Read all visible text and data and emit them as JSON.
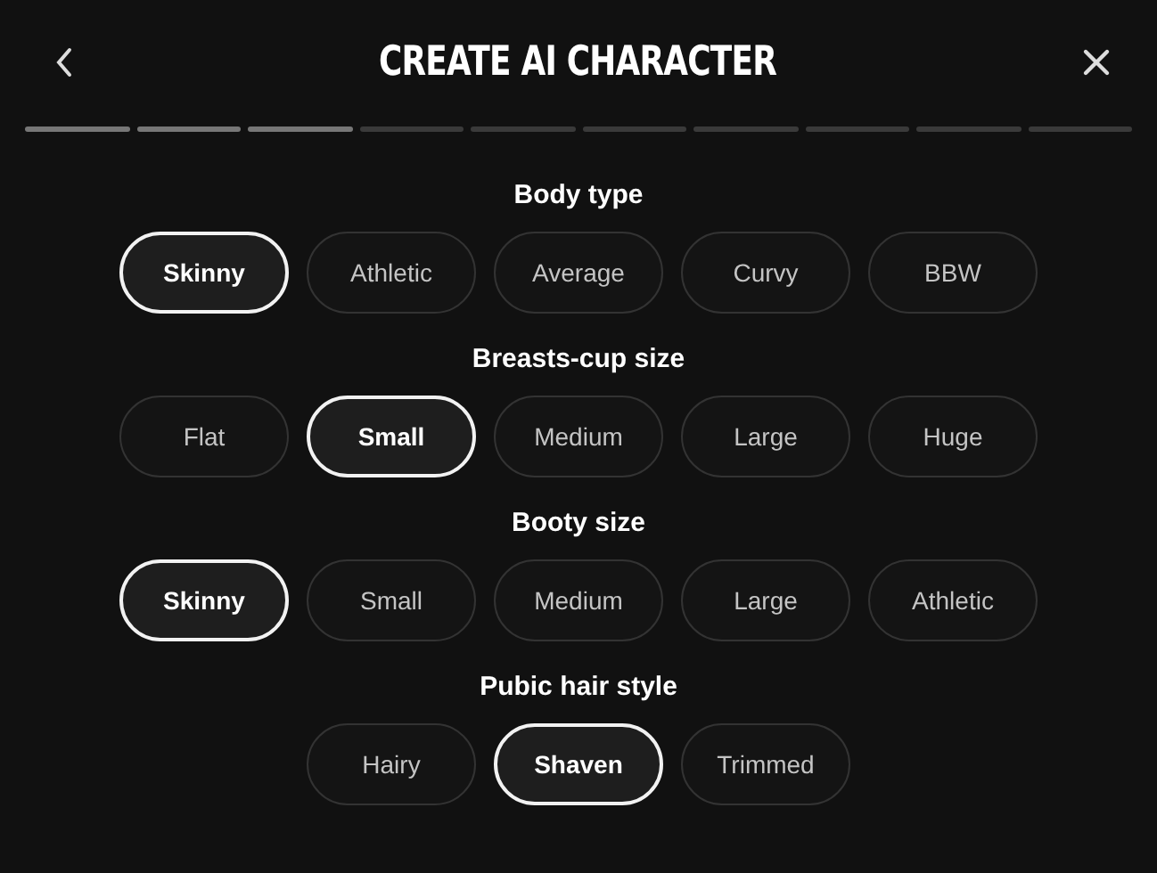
{
  "title": "CREATE AI CHARACTER",
  "progress": [
    {
      "done": true
    },
    {
      "done": true
    },
    {
      "done": true
    },
    {
      "done": false
    },
    {
      "done": false
    },
    {
      "done": false
    },
    {
      "done": false
    },
    {
      "done": false
    },
    {
      "done": false
    },
    {
      "done": false
    }
  ],
  "sections": [
    {
      "heading": "Body type",
      "options": [
        {
          "label": "Skinny",
          "selected": true
        },
        {
          "label": "Athletic",
          "selected": false
        },
        {
          "label": "Average",
          "selected": false
        },
        {
          "label": "Curvy",
          "selected": false
        },
        {
          "label": "BBW",
          "selected": false
        }
      ]
    },
    {
      "heading": "Breasts-cup size",
      "options": [
        {
          "label": "Flat",
          "selected": false
        },
        {
          "label": "Small",
          "selected": true
        },
        {
          "label": "Medium",
          "selected": false
        },
        {
          "label": "Large",
          "selected": false
        },
        {
          "label": "Huge",
          "selected": false
        }
      ]
    },
    {
      "heading": "Booty size",
      "options": [
        {
          "label": "Skinny",
          "selected": true
        },
        {
          "label": "Small",
          "selected": false
        },
        {
          "label": "Medium",
          "selected": false
        },
        {
          "label": "Large",
          "selected": false
        },
        {
          "label": "Athletic",
          "selected": false
        }
      ]
    },
    {
      "heading": "Pubic hair style",
      "options": [
        {
          "label": "Hairy",
          "selected": false
        },
        {
          "label": "Shaven",
          "selected": true
        },
        {
          "label": "Trimmed",
          "selected": false
        }
      ]
    }
  ]
}
